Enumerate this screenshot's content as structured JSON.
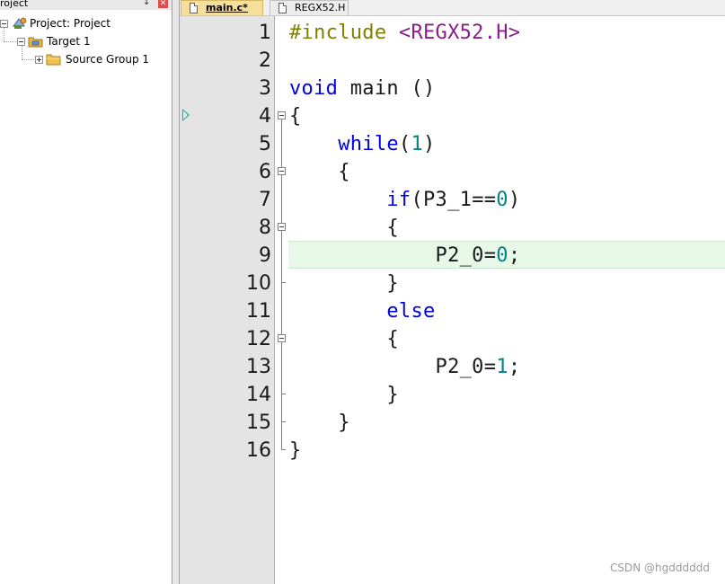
{
  "project_panel": {
    "title": "roject",
    "tree": [
      {
        "label": "Project: Project"
      },
      {
        "label": "Target 1"
      },
      {
        "label": "Source Group 1"
      }
    ]
  },
  "tabs": [
    {
      "label": "main.c*",
      "active": true
    },
    {
      "label": "REGX52.H",
      "active": false
    }
  ],
  "editor": {
    "current_line": 9,
    "bookmark_line": 4,
    "lines": [
      {
        "num": "1",
        "indent": "",
        "tokens": [
          {
            "t": "#include ",
            "c": "pre"
          },
          {
            "t": "<REGX52.H>",
            "c": "inc"
          }
        ]
      },
      {
        "num": "2",
        "indent": "",
        "tokens": []
      },
      {
        "num": "3",
        "indent": "",
        "tokens": [
          {
            "t": "void",
            "c": "kw"
          },
          {
            "t": " main ()",
            "c": "txt"
          }
        ]
      },
      {
        "num": "4",
        "indent": "",
        "tokens": [
          {
            "t": "{",
            "c": "txt"
          }
        ]
      },
      {
        "num": "5",
        "indent": "    ",
        "tokens": [
          {
            "t": "while",
            "c": "kw"
          },
          {
            "t": "(",
            "c": "txt"
          },
          {
            "t": "1",
            "c": "num"
          },
          {
            "t": ")",
            "c": "txt"
          }
        ]
      },
      {
        "num": "6",
        "indent": "    ",
        "tokens": [
          {
            "t": "{",
            "c": "txt"
          }
        ]
      },
      {
        "num": "7",
        "indent": "        ",
        "tokens": [
          {
            "t": "if",
            "c": "kw"
          },
          {
            "t": "(P3_1==",
            "c": "txt"
          },
          {
            "t": "0",
            "c": "num"
          },
          {
            "t": ")",
            "c": "txt"
          }
        ]
      },
      {
        "num": "8",
        "indent": "        ",
        "tokens": [
          {
            "t": "{",
            "c": "txt"
          }
        ]
      },
      {
        "num": "9",
        "indent": "            ",
        "tokens": [
          {
            "t": "P2_0=",
            "c": "txt"
          },
          {
            "t": "0",
            "c": "num"
          },
          {
            "t": ";",
            "c": "txt"
          }
        ]
      },
      {
        "num": "10",
        "indent": "        ",
        "tokens": [
          {
            "t": "}",
            "c": "txt"
          }
        ]
      },
      {
        "num": "11",
        "indent": "        ",
        "tokens": [
          {
            "t": "else",
            "c": "kw"
          }
        ]
      },
      {
        "num": "12",
        "indent": "        ",
        "tokens": [
          {
            "t": "{",
            "c": "txt"
          }
        ]
      },
      {
        "num": "13",
        "indent": "            ",
        "tokens": [
          {
            "t": "P2_0=",
            "c": "txt"
          },
          {
            "t": "1",
            "c": "num"
          },
          {
            "t": ";",
            "c": "txt"
          }
        ]
      },
      {
        "num": "14",
        "indent": "        ",
        "tokens": [
          {
            "t": "}",
            "c": "txt"
          }
        ]
      },
      {
        "num": "15",
        "indent": "    ",
        "tokens": [
          {
            "t": "}",
            "c": "txt"
          }
        ]
      },
      {
        "num": "16",
        "indent": "",
        "tokens": [
          {
            "t": "}",
            "c": "txt"
          }
        ]
      }
    ]
  },
  "colors": {
    "keyword": "#0000e6",
    "number": "#008484",
    "preprocessor": "#808000",
    "include_path": "#8b1c8b",
    "current_line_bg": "#e8f8e8",
    "active_tab_bg": "#f6de9c"
  },
  "watermark": "CSDN @hgdddddd"
}
